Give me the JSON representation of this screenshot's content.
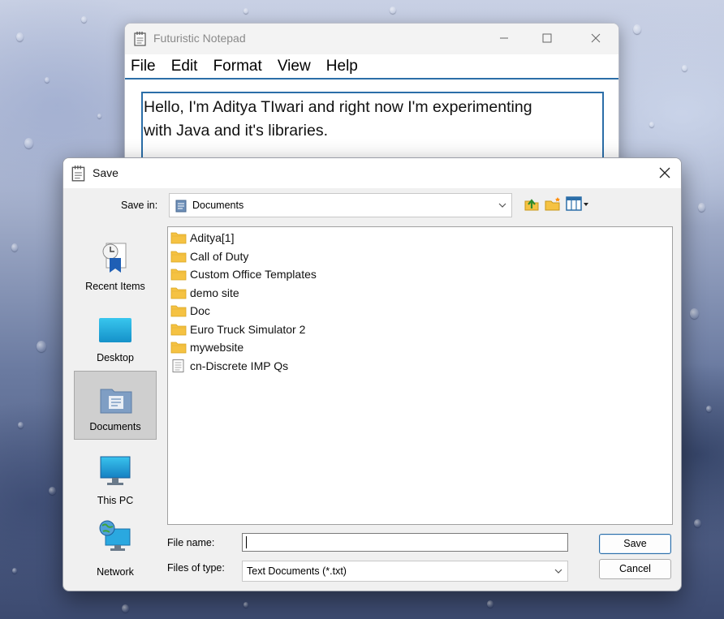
{
  "notepad": {
    "title": "Futuristic Notepad",
    "menu": [
      "File",
      "Edit",
      "Format",
      "View",
      "Help"
    ],
    "content_line1": "Hello, I'm Aditya TIwari and right now I'm experimenting",
    "content_line2": "with Java and it's libraries."
  },
  "dialog": {
    "title": "Save",
    "save_in_label": "Save in:",
    "save_in_value": "Documents",
    "places": [
      {
        "label": "Recent Items",
        "icon": "recent-items-icon",
        "selected": false
      },
      {
        "label": "Desktop",
        "icon": "desktop-icon",
        "selected": false
      },
      {
        "label": "Documents",
        "icon": "documents-icon",
        "selected": true
      },
      {
        "label": "This PC",
        "icon": "this-pc-icon",
        "selected": false
      },
      {
        "label": "Network",
        "icon": "network-icon",
        "selected": false
      }
    ],
    "files": [
      {
        "name": "Aditya[1]",
        "type": "folder"
      },
      {
        "name": "Call of Duty",
        "type": "folder"
      },
      {
        "name": "Custom Office Templates",
        "type": "folder"
      },
      {
        "name": "demo site",
        "type": "folder"
      },
      {
        "name": "Doc",
        "type": "folder"
      },
      {
        "name": "Euro Truck Simulator 2",
        "type": "folder"
      },
      {
        "name": "mywebsite",
        "type": "folder"
      },
      {
        "name": "cn-Discrete IMP Qs",
        "type": "file"
      }
    ],
    "file_name_label": "File name:",
    "file_name_value": "",
    "files_of_type_label": "Files of type:",
    "files_of_type_value": "Text Documents (*.txt)",
    "save_button": "Save",
    "cancel_button": "Cancel"
  },
  "colors": {
    "accent": "#2b6ea8",
    "folder": "#f5c242",
    "selected_place": "#cfcfcf"
  }
}
